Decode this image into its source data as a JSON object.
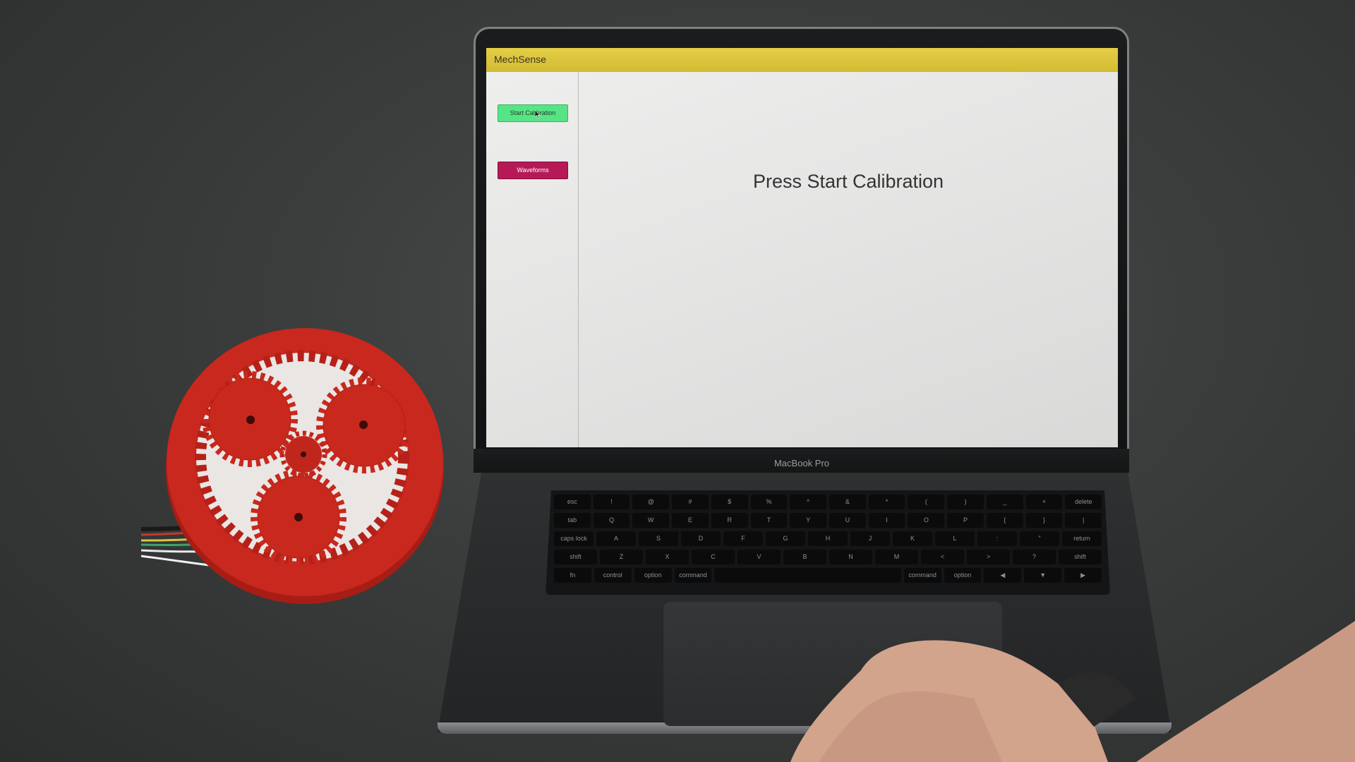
{
  "app": {
    "title": "MechSense",
    "buttons": {
      "start_calibration": "Start Calibration",
      "waveforms": "Waveforms"
    },
    "message": "Press Start Calibration",
    "colors": {
      "titlebar": "#dcc43c",
      "start_button": "#57e486",
      "waveforms_button": "#b51a57"
    }
  },
  "laptop": {
    "brand_label": "MacBook Pro"
  },
  "device": {
    "description_color": "#c8281e"
  },
  "keyboard": {
    "rows": [
      [
        "esc",
        "!",
        "@",
        "#",
        "$",
        "%",
        "^",
        "&",
        "*",
        "(",
        ")",
        "_",
        "+",
        "delete"
      ],
      [
        "tab",
        "Q",
        "W",
        "E",
        "R",
        "T",
        "Y",
        "U",
        "I",
        "O",
        "P",
        "{",
        "}",
        "|"
      ],
      [
        "caps lock",
        "A",
        "S",
        "D",
        "F",
        "G",
        "H",
        "J",
        "K",
        "L",
        ":",
        "\"",
        "return"
      ],
      [
        "shift",
        "Z",
        "X",
        "C",
        "V",
        "B",
        "N",
        "M",
        "<",
        ">",
        "?",
        "shift"
      ],
      [
        "fn",
        "control",
        "option",
        "command",
        "",
        "command",
        "option",
        "◀",
        "▼",
        "▶"
      ]
    ]
  }
}
